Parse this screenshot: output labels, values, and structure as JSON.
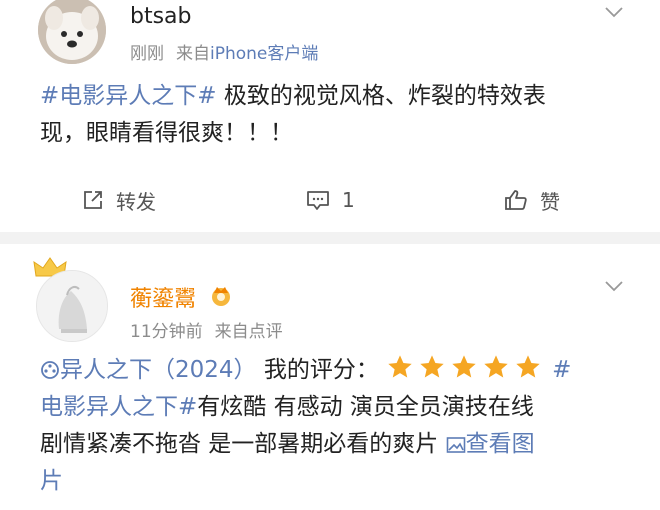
{
  "post1": {
    "username": "btsab",
    "time": "刚刚",
    "source_prefix": "来自",
    "source": "iPhone客户端",
    "topic": "#电影异人之下#",
    "text_line1_rest": " 极致的视觉风格、炸裂的特效表",
    "text_line2": "现，眼睛看得很爽！！！",
    "actions": {
      "repost_label": "转发",
      "comment_count": "1",
      "like_label": "赞"
    }
  },
  "post2": {
    "username": "蘅鎏鬻",
    "time": "11分钟前",
    "source": "来自点评",
    "movie_link": "异人之下（2024）",
    "rating_label": " 我的评分：",
    "rating": 5,
    "rating_max": 5,
    "topic_hash": "#",
    "topic": "电影异人之下#",
    "text_rest": "有炫酷 有感动 演员全员演技在线",
    "text_line3": "剧情紧凑不拖沓 是一部暑期必看的爽片",
    "view_image_label": "查看图",
    "view_image_label_tail": "片"
  },
  "colors": {
    "link": "#5d7cb6",
    "star": "#f5a623",
    "vip_name": "#f08300",
    "meta": "#8c8c8c"
  },
  "icons": [
    "chevron-down-icon",
    "repost-icon",
    "comment-icon",
    "like-icon",
    "star-icon",
    "movie-icon",
    "image-icon",
    "crown-icon",
    "vip-badge-icon"
  ]
}
